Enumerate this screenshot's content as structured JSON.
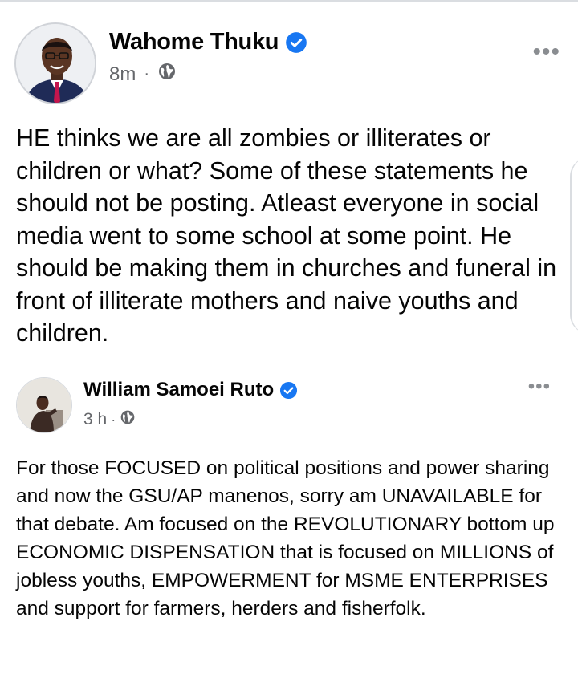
{
  "post": {
    "author": "Wahome Thuku",
    "time": "8m",
    "separator": "·",
    "more": "•••",
    "body": "HE thinks we are all zombies or illiterates or children or what? Some of these statements he should not be posting. Atleast everyone in social media went to some school at some point. He should be making them in churches and funeral in front of illiterate mothers and naive youths and children."
  },
  "shared": {
    "author": "William Samoei Ruto",
    "time": "3 h",
    "separator": "·",
    "more": "•••",
    "body": "For those FOCUSED on political positions and power sharing and now the GSU/AP manenos, sorry am UNAVAILABLE for that debate. Am focused on the REVOLUTIONARY bottom up ECONOMIC DISPENSATION that is focused on MILLIONS of jobless youths, EMPOWERMENT for MSME ENTERPRISES and support for farmers, herders and fisherfolk."
  },
  "colors": {
    "verified": "#1877f2",
    "meta": "#65676b",
    "text": "#050505"
  },
  "icons": {
    "verified": "verified-badge-icon",
    "audience": "globe-icon",
    "more": "more-options-icon"
  }
}
